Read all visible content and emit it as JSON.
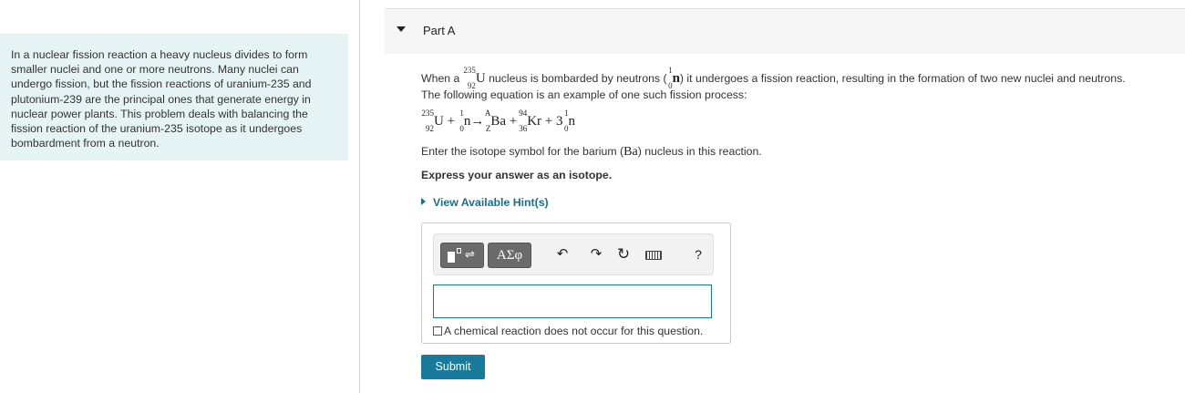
{
  "intro": {
    "text": "In a nuclear fission reaction a heavy nucleus divides to form smaller nuclei and one or more neutrons. Many nuclei can undergo fission, but the fission reactions of uranium-235 and plutonium-239 are the principal ones that generate energy in nuclear power plants. This problem deals with balancing the fission reaction of the uranium-235 isotope as it undergoes bombardment from a neutron."
  },
  "part": {
    "label": "Part A"
  },
  "question": {
    "line1_pre": "When a",
    "u_mass": "235",
    "u_num": "92",
    "u_sym": "U",
    "line1_mid": "nucleus is bombarded by neutrons (",
    "n_mass": "1",
    "n_num": "0",
    "n_sym": "n",
    "line1_post": ") it undergoes a fission reaction, resulting in the formation of two new nuclei and neutrons.",
    "line2": "The following equation is an example of one such fission process:",
    "eq": {
      "u_mass": "235",
      "u_num": "92",
      "u_sym": "U",
      "plus1": "+",
      "n_mass": "1",
      "n_num": "0",
      "n_sym": "n",
      "arrow": "→",
      "ba_mass": "A",
      "ba_num": "Z",
      "ba_sym": "Ba",
      "plus2": "+",
      "kr_mass": "94",
      "kr_num": "36",
      "kr_sym": "Kr",
      "plus3": "+ 3",
      "n2_mass": "1",
      "n2_num": "0",
      "n2_sym": "n"
    },
    "prompt_pre": "Enter the isotope symbol for the barium (",
    "prompt_sym": "Ba",
    "prompt_post": ") nucleus in this reaction.",
    "express": "Express your answer as an isotope."
  },
  "hints": {
    "label": "View Available Hint(s)"
  },
  "toolbar": {
    "symbols_label": "ΑΣφ",
    "undo_icon": "↶",
    "redo_icon": "↷",
    "reset_icon": "↻",
    "help_label": "?"
  },
  "answer": {
    "value": "",
    "no_reaction_label": "A chemical reaction does not occur for this question.",
    "no_reaction_checked": false
  },
  "submit": {
    "label": "Submit"
  },
  "colors": {
    "accent": "#1a7a9c",
    "left_panel_bg": "#e6f3f4"
  }
}
